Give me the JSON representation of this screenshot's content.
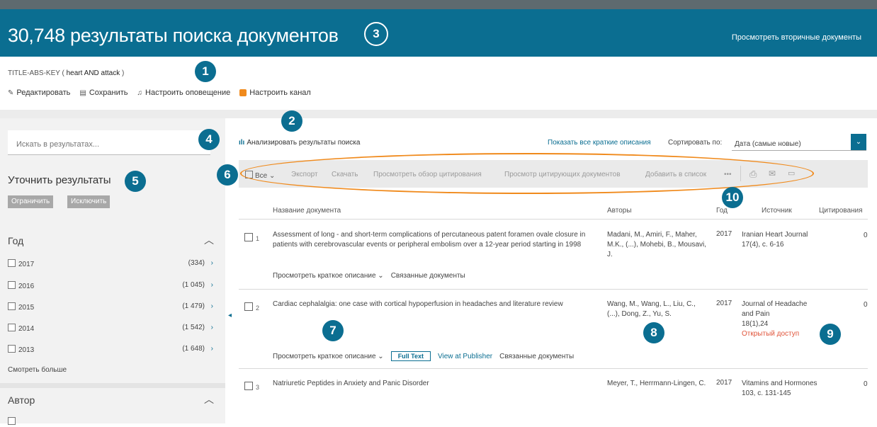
{
  "header": {
    "title": "30,748 результаты поиска документов",
    "secondary_link": "Просмотреть вторичные документы"
  },
  "query": {
    "prefix": "TITLE-ABS-KEY ( ",
    "terms": "heart  AND attack",
    "suffix": " )"
  },
  "query_actions": {
    "edit": "Редактировать",
    "save": "Сохранить",
    "alert": "Настроить оповещение",
    "feed": "Настроить канал"
  },
  "sidebar": {
    "search_placeholder": "Искать в результатах...",
    "refine_title": "Уточнить результаты",
    "limit_button": "Ограничить",
    "exclude_button": "Исключить",
    "year_facet": {
      "title": "Год",
      "items": [
        {
          "label": "2017",
          "count": "(334)"
        },
        {
          "label": "2016",
          "count": "(1 045)"
        },
        {
          "label": "2015",
          "count": "(1 479)"
        },
        {
          "label": "2014",
          "count": "(1 542)"
        },
        {
          "label": "2013",
          "count": "(1 648)"
        }
      ],
      "show_more": "Смотреть больше"
    },
    "author_facet": {
      "title": "Автор"
    }
  },
  "results_bar": {
    "analyze": "Анализировать результаты поиска",
    "show_all_abstracts": "Показать все краткие описания",
    "sort_label": "Сортировать по:",
    "sort_value": "Дата (самые новые)"
  },
  "toolbar": {
    "all": "Все",
    "export": "Экспорт",
    "download": "Скачать",
    "citation_overview": "Просмотреть обзор цитирования",
    "cited_by": "Просмотр цитирующих документов",
    "add_to_list": "Добавить в список",
    "more": "•••"
  },
  "columns": {
    "title": "Название документа",
    "authors": "Авторы",
    "year": "Год",
    "source": "Источник",
    "citations": "Цитирования"
  },
  "results": [
    {
      "num": "1",
      "title": "Assessment of long - and short-term complications of percutaneous patent foramen ovale closure in patients with cerebrovascular events or peripheral embolism over a 12-year period starting in 1998",
      "authors": "Madani, M., Amiri, F., Maher, M.K., (...), Mohebi, B., Mousavi, J.",
      "year": "2017",
      "source_name": "Iranian Heart Journal",
      "source_detail": "17(4), с. 6-16",
      "open_access": "",
      "citations": "0",
      "view_abstract": "Просмотреть краткое описание",
      "related": "Связанные документы"
    },
    {
      "num": "2",
      "title": "Cardiac cephalalgia: one case with cortical hypoperfusion in headaches and literature review",
      "authors": "Wang, M., Wang, L., Liu, C., (...), Dong, Z., Yu, S.",
      "year": "2017",
      "source_name": "Journal of Headache and Pain",
      "source_detail": "18(1),24",
      "open_access": "Открытый доступ",
      "citations": "0",
      "view_abstract": "Просмотреть краткое описание",
      "full_text": "Full Text",
      "view_publisher": "View at Publisher",
      "related": "Связанные документы"
    },
    {
      "num": "3",
      "title": "Natriuretic Peptides in Anxiety and Panic Disorder",
      "authors": "Meyer, T., Herrmann-Lingen, C.",
      "year": "2017",
      "source_name": "Vitamins and Hormones",
      "source_detail": "103, с. 131-145",
      "open_access": "",
      "citations": "0"
    }
  ],
  "callouts": [
    "1",
    "2",
    "3",
    "4",
    "5",
    "6",
    "7",
    "8",
    "9",
    "10"
  ],
  "colors": {
    "header_bg": "#0b6e91",
    "callout_ring": "#f08a1c",
    "open_access": "#e0543a"
  }
}
